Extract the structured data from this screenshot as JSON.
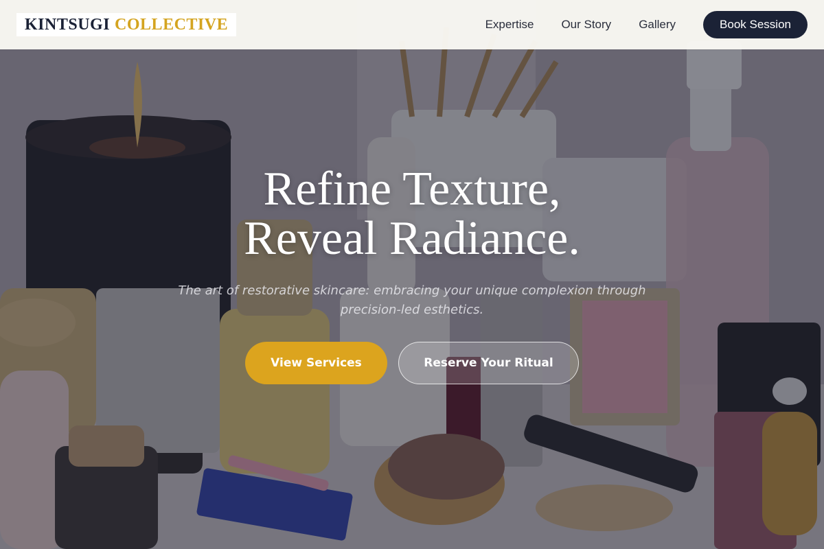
{
  "brand": {
    "word1": "KINTSUGI",
    "word2": "COLLECTIVE"
  },
  "nav": {
    "items": [
      {
        "label": "Expertise"
      },
      {
        "label": "Our Story"
      },
      {
        "label": "Gallery"
      }
    ],
    "cta_label": "Book Session"
  },
  "hero": {
    "title_line1": "Refine Texture,",
    "title_line2": "Reveal Radiance.",
    "subtitle": "The art of restorative skincare: embracing your unique complexion through precision-led esthetics.",
    "primary_cta": "View Services",
    "secondary_cta": "Reserve Your Ritual",
    "background_image": "cosmetics-vanity-photo"
  },
  "colors": {
    "navy": "#1b2236",
    "gold": "#dca41e",
    "header_bg": "#faf9f4"
  }
}
